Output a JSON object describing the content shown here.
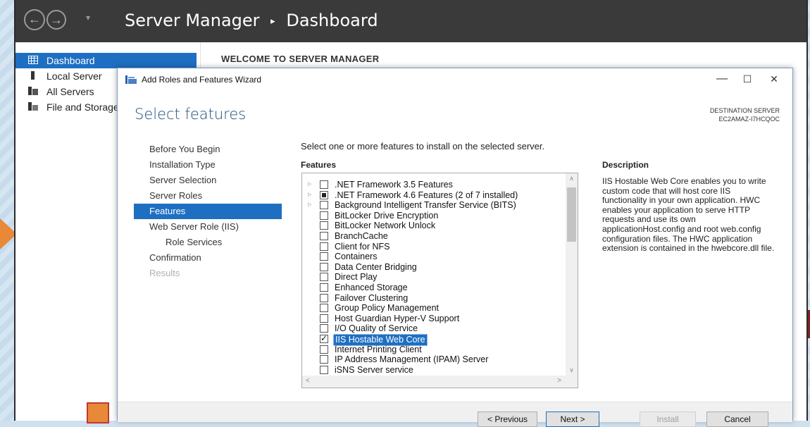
{
  "app": {
    "title": "Server Manager",
    "breadcrumb_sep": "▸",
    "page": "Dashboard"
  },
  "sidebar": {
    "items": [
      {
        "label": "Dashboard",
        "icon": "dashboard-grid-icon"
      },
      {
        "label": "Local Server",
        "icon": "server-icon"
      },
      {
        "label": "All Servers",
        "icon": "servers-icon"
      },
      {
        "label": "File and Storage",
        "icon": "storage-icon"
      }
    ]
  },
  "main": {
    "welcome": "WELCOME TO SERVER MANAGER"
  },
  "wizard": {
    "title": "Add Roles and Features Wizard",
    "heading": "Select features",
    "destination_label": "DESTINATION SERVER",
    "destination_server": "EC2AMAZ-I7HCQOC",
    "steps": [
      {
        "label": "Before You Begin",
        "state": "normal"
      },
      {
        "label": "Installation Type",
        "state": "normal"
      },
      {
        "label": "Server Selection",
        "state": "normal"
      },
      {
        "label": "Server Roles",
        "state": "normal"
      },
      {
        "label": "Features",
        "state": "active"
      },
      {
        "label": "Web Server Role (IIS)",
        "state": "normal"
      },
      {
        "label": "Role Services",
        "state": "sub"
      },
      {
        "label": "Confirmation",
        "state": "normal"
      },
      {
        "label": "Results",
        "state": "disabled"
      }
    ],
    "intro": "Select one or more features to install on the selected server.",
    "features_label": "Features",
    "description_label": "Description",
    "description": "IIS Hostable Web Core enables you to write custom code that will host core IIS functionality in your own application. HWC enables your application to serve HTTP requests and use its own applicationHost.config and root web.config configuration files. The HWC application extension is contained in the hwebcore.dll file.",
    "features": [
      {
        "label": ".NET Framework 3.5 Features",
        "expandable": true,
        "state": "unchecked"
      },
      {
        "label": ".NET Framework 4.6 Features (2 of 7 installed)",
        "expandable": true,
        "state": "partial"
      },
      {
        "label": "Background Intelligent Transfer Service (BITS)",
        "expandable": true,
        "state": "unchecked"
      },
      {
        "label": "BitLocker Drive Encryption",
        "expandable": false,
        "state": "unchecked"
      },
      {
        "label": "BitLocker Network Unlock",
        "expandable": false,
        "state": "unchecked"
      },
      {
        "label": "BranchCache",
        "expandable": false,
        "state": "unchecked"
      },
      {
        "label": "Client for NFS",
        "expandable": false,
        "state": "unchecked"
      },
      {
        "label": "Containers",
        "expandable": false,
        "state": "unchecked"
      },
      {
        "label": "Data Center Bridging",
        "expandable": false,
        "state": "unchecked"
      },
      {
        "label": "Direct Play",
        "expandable": false,
        "state": "unchecked"
      },
      {
        "label": "Enhanced Storage",
        "expandable": false,
        "state": "unchecked"
      },
      {
        "label": "Failover Clustering",
        "expandable": false,
        "state": "unchecked"
      },
      {
        "label": "Group Policy Management",
        "expandable": false,
        "state": "unchecked"
      },
      {
        "label": "Host Guardian Hyper-V Support",
        "expandable": false,
        "state": "unchecked"
      },
      {
        "label": "I/O Quality of Service",
        "expandable": false,
        "state": "unchecked"
      },
      {
        "label": "IIS Hostable Web Core",
        "expandable": false,
        "state": "checked",
        "selected": true
      },
      {
        "label": "Internet Printing Client",
        "expandable": false,
        "state": "unchecked"
      },
      {
        "label": "IP Address Management (IPAM) Server",
        "expandable": false,
        "state": "unchecked"
      },
      {
        "label": "iSNS Server service",
        "expandable": false,
        "state": "unchecked"
      }
    ],
    "buttons": {
      "previous": "< Previous",
      "next": "Next >",
      "install": "Install",
      "cancel": "Cancel"
    },
    "controls": {
      "minimize": "—",
      "maximize": "☐",
      "close": "✕"
    }
  },
  "colors": {
    "accent": "#1e6fc2",
    "titlebar": "#3a3a3a",
    "marker": "#e8893a"
  }
}
